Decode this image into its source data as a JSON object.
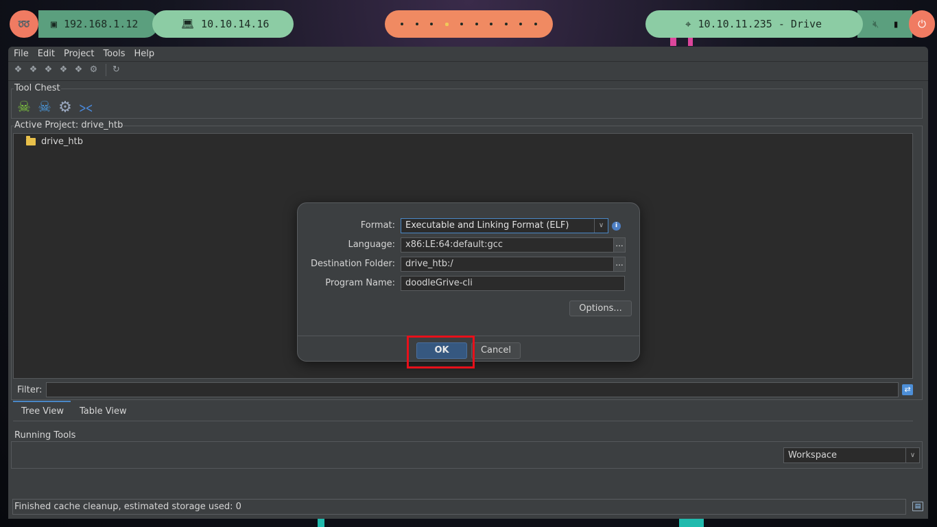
{
  "topbar": {
    "lan_ip": "192.168.1.12",
    "vpn_ip": "10.10.14.16",
    "target": "10.10.11.235 - Drive",
    "workspaces": [
      {
        "active": false
      },
      {
        "active": false
      },
      {
        "active": false
      },
      {
        "active": true
      },
      {
        "active": false
      },
      {
        "active": false
      },
      {
        "active": false
      },
      {
        "active": false
      },
      {
        "active": false
      },
      {
        "active": false
      }
    ]
  },
  "menu": {
    "file": "File",
    "edit": "Edit",
    "project": "Project",
    "tools": "Tools",
    "help": "Help"
  },
  "tool_chest": {
    "title": "Tool Chest"
  },
  "project": {
    "title": "Active Project: drive_htb",
    "root_folder": "drive_htb"
  },
  "filter": {
    "label": "Filter:",
    "value": ""
  },
  "tabs": {
    "tree_view": "Tree View",
    "table_view": "Table View"
  },
  "running_tools": {
    "title": "Running Tools",
    "workspace": "Workspace"
  },
  "status": {
    "message": "Finished cache cleanup, estimated storage used: 0"
  },
  "dialog": {
    "format_label": "Format:",
    "format_value": "Executable and Linking Format (ELF)",
    "language_label": "Language:",
    "language_value": "x86:LE:64:default:gcc",
    "dest_label": "Destination Folder:",
    "dest_value": "drive_htb:/",
    "program_label": "Program Name:",
    "program_value": "doodleGrive-cli",
    "options_label": "Options...",
    "ok_label": "OK",
    "cancel_label": "Cancel",
    "browse_label": "..."
  },
  "colors": {
    "accent_blue": "#4a88c7",
    "highlight_red": "#e8101a",
    "ok_button": "#365880"
  }
}
